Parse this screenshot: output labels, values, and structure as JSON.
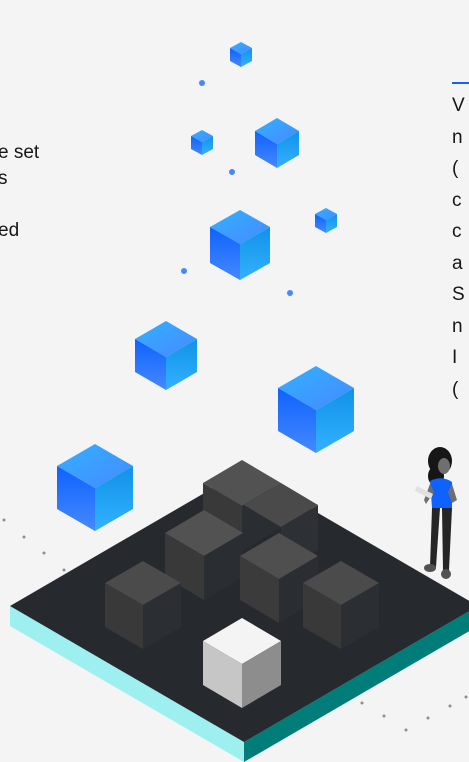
{
  "left_fragments": [
    "e set",
    "s",
    "",
    "ed"
  ],
  "right_fragments": [
    "V",
    "n",
    "(",
    "c",
    "c",
    "a",
    "S",
    "n",
    "I",
    "("
  ],
  "colors": {
    "background": "#f4f4f4",
    "link_blue": "#0f62fe",
    "cube_blue_top": "#3aa0ff",
    "platform_dark": "#262a2e",
    "platform_teal": "#3ddbd9"
  },
  "illustration": {
    "subject": "isometric-cube-platform",
    "person": "person-holding-tablet"
  }
}
